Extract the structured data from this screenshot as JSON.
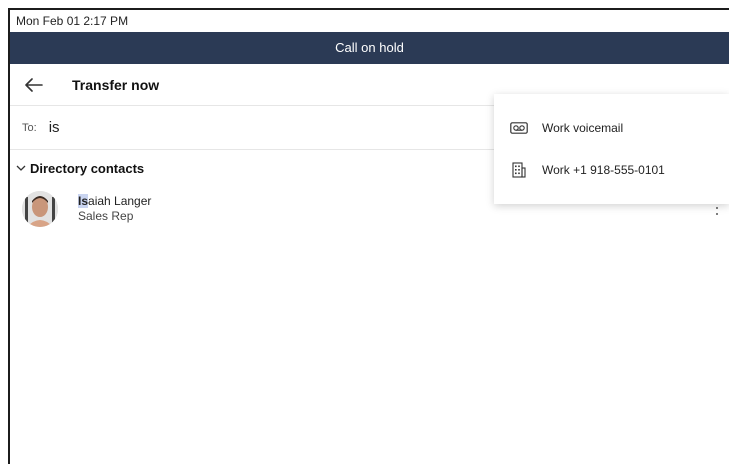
{
  "status_bar": {
    "datetime": "Mon Feb 01  2:17 PM"
  },
  "banner": {
    "text": "Call on hold"
  },
  "header": {
    "title": "Transfer now",
    "back_icon": "arrow-left-icon"
  },
  "to_field": {
    "label": "To:",
    "value": "is"
  },
  "directory": {
    "section_title": "Directory contacts",
    "contacts": [
      {
        "name_match": "Is",
        "name_rest": "aiah Langer",
        "subtitle": "Sales Rep"
      }
    ]
  },
  "popup_menu": {
    "items": [
      {
        "label": "Work voicemail",
        "icon": "voicemail-icon"
      },
      {
        "label": "Work +1 918-555-0101",
        "icon": "building-icon"
      }
    ]
  },
  "colors": {
    "banner_bg": "#2b3a55",
    "highlight": "#c9d4f0"
  }
}
